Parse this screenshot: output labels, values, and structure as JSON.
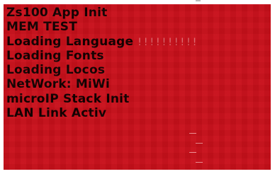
{
  "screen": {
    "background_color": "#c8101b",
    "text_color": "#120000",
    "boot_lines": [
      "Zs100 App Init",
      "MEM TEST",
      "Loading Language",
      "Loading Fonts",
      "Loading Locos",
      "NetWork: MiWi",
      "microIP Stack Init",
      "LAN Link Activ"
    ],
    "language_progress": "!!!!!!!!!!"
  }
}
